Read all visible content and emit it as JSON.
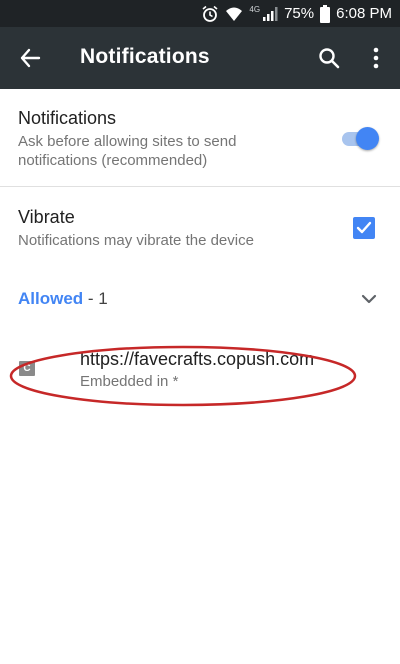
{
  "status_bar": {
    "network": "4G",
    "battery": "75%",
    "time": "6:08 PM",
    "icons": [
      "alarm-icon",
      "wifi-icon",
      "signal-icon",
      "battery-icon"
    ]
  },
  "app_bar": {
    "title": "Notifications",
    "background": "#2c3337",
    "icons": [
      "back-arrow-icon",
      "search-icon",
      "more-vert-icon"
    ]
  },
  "notifications_setting": {
    "title": "Notifications",
    "subtitle": "Ask before allowing sites to send notifications (recommended)",
    "enabled": true
  },
  "vibrate_setting": {
    "title": "Vibrate",
    "subtitle": "Notifications may vibrate the device",
    "checked": true
  },
  "allowed_section": {
    "label": "Allowed",
    "count": " - 1",
    "sites": [
      {
        "favicon_letter": "C",
        "url": "https://favecrafts.copush.com",
        "subtitle": "Embedded in *"
      }
    ]
  },
  "colors": {
    "accent": "#4285f4",
    "annotation": "#c62828"
  }
}
